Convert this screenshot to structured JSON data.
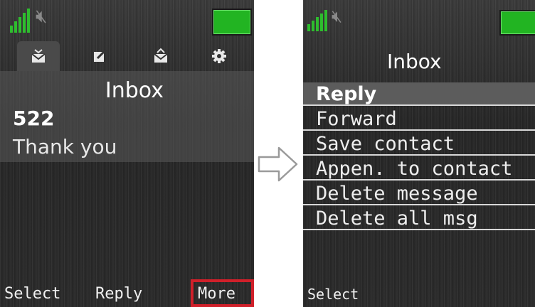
{
  "left_screen": {
    "title": "Inbox",
    "message": {
      "sender": "522",
      "body": "Thank you"
    },
    "tabs": [
      {
        "icon": "inbox-icon"
      },
      {
        "icon": "compose-icon"
      },
      {
        "icon": "outbox-icon"
      },
      {
        "icon": "settings-icon"
      }
    ],
    "softkeys": {
      "left": "Select",
      "center": "Reply",
      "right": "More"
    }
  },
  "right_screen": {
    "title": "Inbox",
    "menu": [
      "Reply",
      "Forward",
      "Save contact",
      "Appen. to contact",
      "Delete message",
      "Delete all msg"
    ],
    "selected_index": 0,
    "softkeys": {
      "left": "Select"
    }
  },
  "colors": {
    "signal": "#2ebd2e",
    "battery": "#22b422",
    "highlight": "#d0202a"
  }
}
